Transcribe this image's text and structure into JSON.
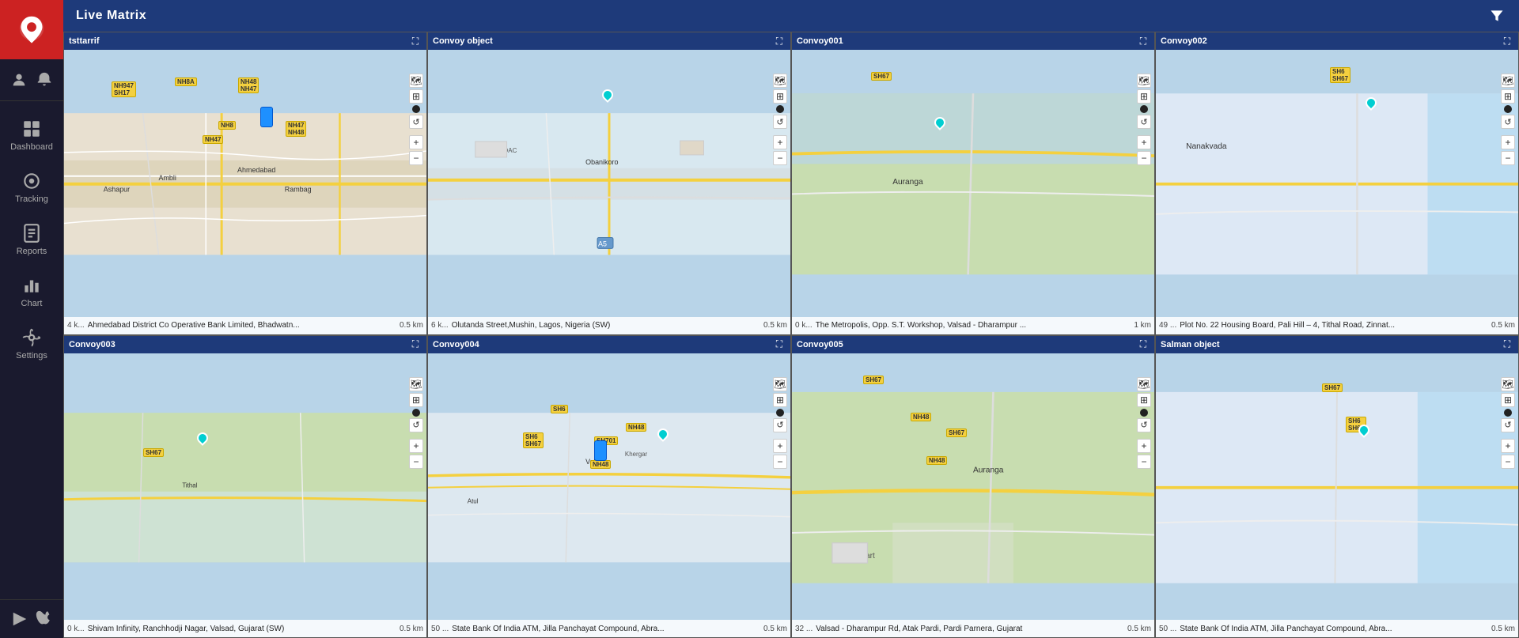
{
  "app": {
    "title": "Live Matrix"
  },
  "sidebar": {
    "logo_alt": "App Logo",
    "nav_items": [
      {
        "id": "dashboard",
        "label": "Dashboard",
        "active": false
      },
      {
        "id": "tracking",
        "label": "Tracking",
        "active": false
      },
      {
        "id": "reports",
        "label": "Reports",
        "active": false
      },
      {
        "id": "chart",
        "label": "Chart",
        "active": false
      },
      {
        "id": "settings",
        "label": "Settings",
        "active": false
      }
    ],
    "bottom_icons": [
      "play-store-icon",
      "apple-store-icon"
    ]
  },
  "map_cells": [
    {
      "id": "cell_0",
      "title": "tsttarrif",
      "km": "4 k...",
      "address": "Ahmedabad District Co Operative Bank Limited, Bhadwatn...",
      "scale": "0.5 km",
      "bg_color": "#cde3f0"
    },
    {
      "id": "cell_1",
      "title": "Convoy object",
      "km": "6 k...",
      "address": "Olutanda Street,Mushin, Lagos, Nigeria (SW)",
      "scale": "0.5 km",
      "bg_color": "#cde3f0"
    },
    {
      "id": "cell_2",
      "title": "Convoy001",
      "km": "0 k...",
      "address": "The Metropolis, Opp. S.T. Workshop, Valsad - Dharampur ...",
      "scale": "1 km",
      "bg_color": "#cde3f0"
    },
    {
      "id": "cell_3",
      "title": "Convoy002",
      "km": "49 ...",
      "address": "Plot No. 22 Housing Board, Pali Hill – 4, Tithal Road, Zinnat...",
      "scale": "0.5 km",
      "bg_color": "#cde3f0"
    },
    {
      "id": "cell_4",
      "title": "Convoy003",
      "km": "0 k...",
      "address": "Shivam Infinity, Ranchhodji Nagar, Valsad, Gujarat (SW)",
      "scale": "0.5 km",
      "bg_color": "#cde3f0"
    },
    {
      "id": "cell_5",
      "title": "Convoy004",
      "km": "50 ...",
      "address": "State Bank Of India ATM, Jilla Panchayat Compound, Abra...",
      "scale": "0.5 km",
      "bg_color": "#cde3f0"
    },
    {
      "id": "cell_6",
      "title": "Convoy005",
      "km": "32 ...",
      "address": "Valsad - Dharampur Rd, Atak Pardi, Pardi Parnera, Gujarat",
      "scale": "0.5 km",
      "bg_color": "#cde3f0"
    },
    {
      "id": "cell_7",
      "title": "Salman object",
      "km": "50 ...",
      "address": "State Bank Of India ATM, Jilla Panchayat Compound, Abra...",
      "scale": "0.5 km",
      "bg_color": "#cde3f0"
    },
    {
      "id": "cell_8",
      "title": "",
      "km": "",
      "address": "",
      "scale": "",
      "bg_color": "#cde3f0"
    },
    {
      "id": "cell_9",
      "title": "",
      "km": "",
      "address": "",
      "scale": "",
      "bg_color": "#cde3f0"
    },
    {
      "id": "cell_10",
      "title": "",
      "km": "",
      "address": "",
      "scale": "",
      "bg_color": "#cde3f0"
    },
    {
      "id": "cell_11",
      "title": "",
      "km": "",
      "address": "",
      "scale": "",
      "bg_color": "#cde3f0"
    }
  ]
}
